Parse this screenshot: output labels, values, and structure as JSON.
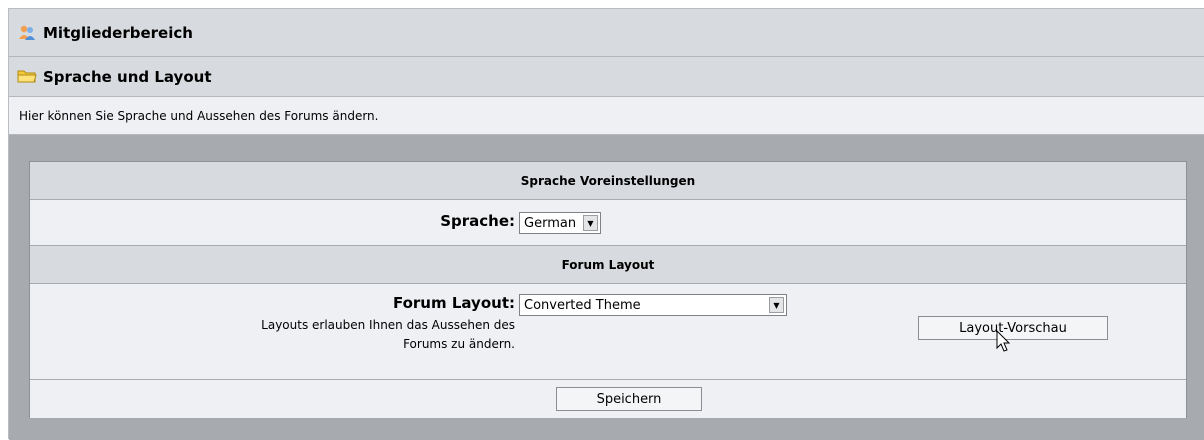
{
  "header": {
    "section_title": "Mitgliederbereich",
    "page_title": "Sprache und Layout"
  },
  "description": "Hier können Sie Sprache und Aussehen des Forums ändern.",
  "language_section": {
    "title": "Sprache Voreinstellungen",
    "label": "Sprache:",
    "selected": "German"
  },
  "layout_section": {
    "title": "Forum Layout",
    "label": "Forum Layout:",
    "selected": "Converted Theme",
    "help_line1": "Layouts erlauben Ihnen das Aussehen des",
    "help_line2": "Forums zu ändern.",
    "preview_button": "Layout-Vorschau"
  },
  "save_button": "Speichern",
  "icons": {
    "members": "members-icon",
    "folder": "folder-icon",
    "cursor": "mouse-pointer-icon"
  },
  "colors": {
    "header_bg": "#d7dade",
    "light_bg": "#eef0f3",
    "outer_grey": "#a7aaae"
  }
}
